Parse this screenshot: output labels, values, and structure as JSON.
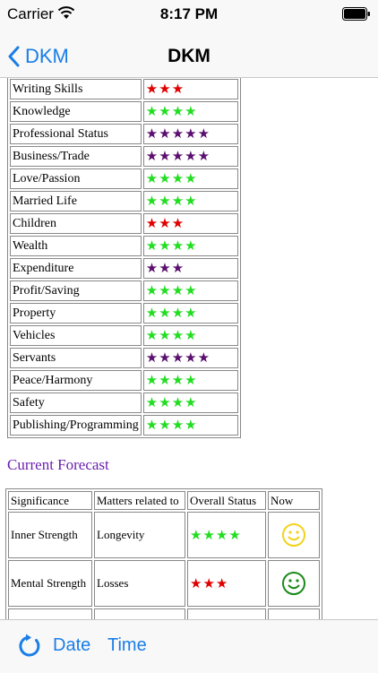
{
  "status_bar": {
    "carrier": "Carrier",
    "time": "8:17 PM"
  },
  "nav": {
    "back_label": "DKM",
    "title": "DKM"
  },
  "colors": {
    "red": "#e00000",
    "green": "#22dd22",
    "purple": "#5a0f6e",
    "heading": "#6a1fb0",
    "accent": "#1a7ee6"
  },
  "ratings": [
    {
      "label": "Writing Skills",
      "stars": "★★★",
      "color": "red"
    },
    {
      "label": "Knowledge",
      "stars": "★★★★",
      "color": "green"
    },
    {
      "label": "Professional Status",
      "stars": "★★★★★",
      "color": "purple"
    },
    {
      "label": "Business/Trade",
      "stars": "★★★★★",
      "color": "purple"
    },
    {
      "label": "Love/Passion",
      "stars": "★★★★",
      "color": "green"
    },
    {
      "label": "Married Life",
      "stars": "★★★★",
      "color": "green"
    },
    {
      "label": "Children",
      "stars": "★★★",
      "color": "red"
    },
    {
      "label": "Wealth",
      "stars": "★★★★",
      "color": "green"
    },
    {
      "label": "Expenditure",
      "stars": "★★★",
      "color": "purple"
    },
    {
      "label": "Profit/Saving",
      "stars": "★★★★",
      "color": "green"
    },
    {
      "label": "Property",
      "stars": "★★★★",
      "color": "green"
    },
    {
      "label": "Vehicles",
      "stars": "★★★★",
      "color": "green"
    },
    {
      "label": "Servants",
      "stars": "★★★★★",
      "color": "purple"
    },
    {
      "label": "Peace/Harmony",
      "stars": "★★★★",
      "color": "green"
    },
    {
      "label": "Safety",
      "stars": "★★★★",
      "color": "green"
    },
    {
      "label": "Publishing/Programming",
      "stars": "★★★★",
      "color": "green"
    }
  ],
  "forecast": {
    "heading": "Current Forecast",
    "headers": [
      "Significance",
      "Matters related to",
      "Overall Status",
      "Now"
    ],
    "rows": [
      {
        "significance": "Inner Strength",
        "matters": "Longevity",
        "stars": "★★★★",
        "color": "green",
        "now_icon": "smiley-yellow-icon"
      },
      {
        "significance": "Mental Strength",
        "matters": "Losses",
        "stars": "★★★",
        "color": "red",
        "now_icon": "smiley-green-icon"
      }
    ]
  },
  "toolbar": {
    "date_label": "Date",
    "time_label": "Time"
  }
}
